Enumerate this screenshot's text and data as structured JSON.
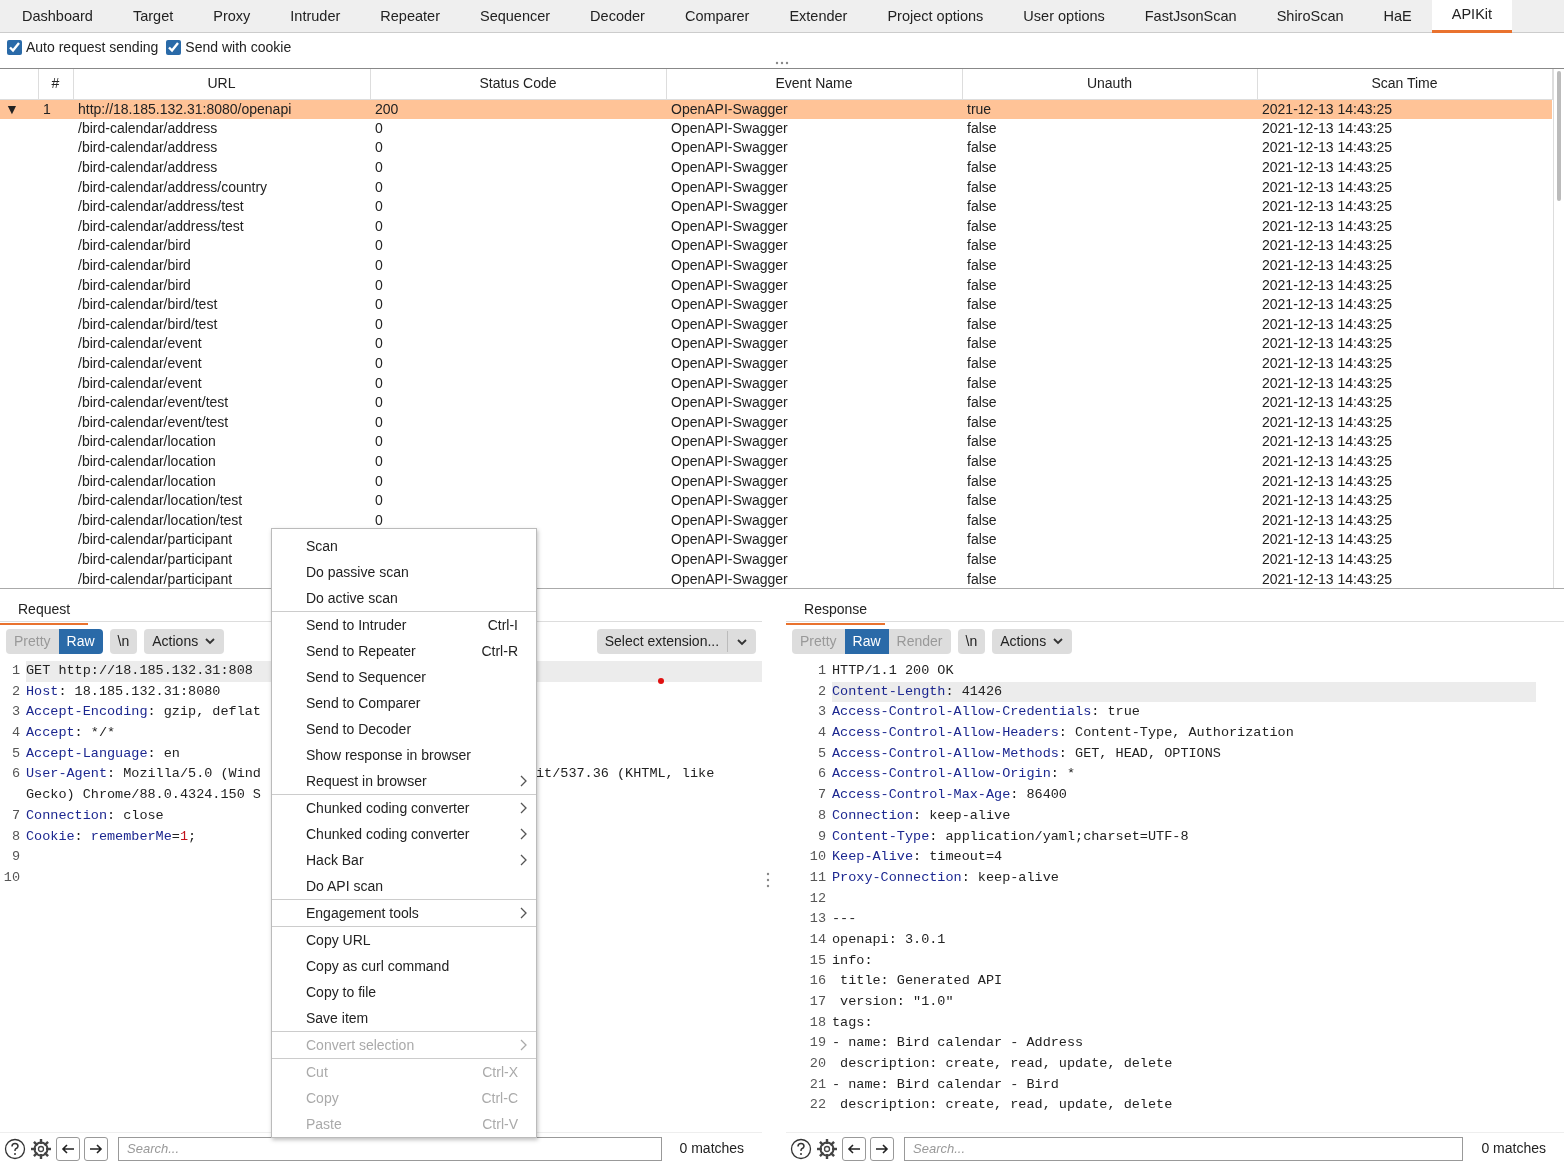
{
  "tabs": [
    {
      "label": "Dashboard",
      "selected": false
    },
    {
      "label": "Target",
      "selected": false
    },
    {
      "label": "Proxy",
      "selected": false
    },
    {
      "label": "Intruder",
      "selected": false
    },
    {
      "label": "Repeater",
      "selected": false
    },
    {
      "label": "Sequencer",
      "selected": false
    },
    {
      "label": "Decoder",
      "selected": false
    },
    {
      "label": "Comparer",
      "selected": false
    },
    {
      "label": "Extender",
      "selected": false
    },
    {
      "label": "Project options",
      "selected": false
    },
    {
      "label": "User options",
      "selected": false
    },
    {
      "label": "FastJsonScan",
      "selected": false
    },
    {
      "label": "ShiroScan",
      "selected": false
    },
    {
      "label": "HaE",
      "selected": false
    },
    {
      "label": "APIKit",
      "selected": true
    }
  ],
  "options": [
    {
      "label": "Auto request sending",
      "checked": true
    },
    {
      "label": "Send with cookie",
      "checked": true
    }
  ],
  "table": {
    "columns": [
      "#",
      "URL",
      "Status Code",
      "Event Name",
      "Unauth",
      "Scan Time"
    ],
    "rows": [
      {
        "expander": "▼",
        "num": "1",
        "url": "http://18.185.132.31:8080/openapi",
        "status": "200",
        "event": "OpenAPI-Swagger",
        "unauth": "true",
        "time": "2021-12-13 14:43:25",
        "selected": true
      },
      {
        "url": "/bird-calendar/address",
        "status": "0",
        "event": "OpenAPI-Swagger",
        "unauth": "false",
        "time": "2021-12-13 14:43:25",
        "selected": false
      },
      {
        "url": "/bird-calendar/address",
        "status": "0",
        "event": "OpenAPI-Swagger",
        "unauth": "false",
        "time": "2021-12-13 14:43:25",
        "selected": false
      },
      {
        "url": "/bird-calendar/address",
        "status": "0",
        "event": "OpenAPI-Swagger",
        "unauth": "false",
        "time": "2021-12-13 14:43:25",
        "selected": false
      },
      {
        "url": "/bird-calendar/address/country",
        "status": "0",
        "event": "OpenAPI-Swagger",
        "unauth": "false",
        "time": "2021-12-13 14:43:25",
        "selected": false
      },
      {
        "url": "/bird-calendar/address/test",
        "status": "0",
        "event": "OpenAPI-Swagger",
        "unauth": "false",
        "time": "2021-12-13 14:43:25",
        "selected": false
      },
      {
        "url": "/bird-calendar/address/test",
        "status": "0",
        "event": "OpenAPI-Swagger",
        "unauth": "false",
        "time": "2021-12-13 14:43:25",
        "selected": false
      },
      {
        "url": "/bird-calendar/bird",
        "status": "0",
        "event": "OpenAPI-Swagger",
        "unauth": "false",
        "time": "2021-12-13 14:43:25",
        "selected": false
      },
      {
        "url": "/bird-calendar/bird",
        "status": "0",
        "event": "OpenAPI-Swagger",
        "unauth": "false",
        "time": "2021-12-13 14:43:25",
        "selected": false
      },
      {
        "url": "/bird-calendar/bird",
        "status": "0",
        "event": "OpenAPI-Swagger",
        "unauth": "false",
        "time": "2021-12-13 14:43:25",
        "selected": false
      },
      {
        "url": "/bird-calendar/bird/test",
        "status": "0",
        "event": "OpenAPI-Swagger",
        "unauth": "false",
        "time": "2021-12-13 14:43:25",
        "selected": false
      },
      {
        "url": "/bird-calendar/bird/test",
        "status": "0",
        "event": "OpenAPI-Swagger",
        "unauth": "false",
        "time": "2021-12-13 14:43:25",
        "selected": false
      },
      {
        "url": "/bird-calendar/event",
        "status": "0",
        "event": "OpenAPI-Swagger",
        "unauth": "false",
        "time": "2021-12-13 14:43:25",
        "selected": false
      },
      {
        "url": "/bird-calendar/event",
        "status": "0",
        "event": "OpenAPI-Swagger",
        "unauth": "false",
        "time": "2021-12-13 14:43:25",
        "selected": false
      },
      {
        "url": "/bird-calendar/event",
        "status": "0",
        "event": "OpenAPI-Swagger",
        "unauth": "false",
        "time": "2021-12-13 14:43:25",
        "selected": false
      },
      {
        "url": "/bird-calendar/event/test",
        "status": "0",
        "event": "OpenAPI-Swagger",
        "unauth": "false",
        "time": "2021-12-13 14:43:25",
        "selected": false
      },
      {
        "url": "/bird-calendar/event/test",
        "status": "0",
        "event": "OpenAPI-Swagger",
        "unauth": "false",
        "time": "2021-12-13 14:43:25",
        "selected": false
      },
      {
        "url": "/bird-calendar/location",
        "status": "0",
        "event": "OpenAPI-Swagger",
        "unauth": "false",
        "time": "2021-12-13 14:43:25",
        "selected": false
      },
      {
        "url": "/bird-calendar/location",
        "status": "0",
        "event": "OpenAPI-Swagger",
        "unauth": "false",
        "time": "2021-12-13 14:43:25",
        "selected": false
      },
      {
        "url": "/bird-calendar/location",
        "status": "0",
        "event": "OpenAPI-Swagger",
        "unauth": "false",
        "time": "2021-12-13 14:43:25",
        "selected": false
      },
      {
        "url": "/bird-calendar/location/test",
        "status": "0",
        "event": "OpenAPI-Swagger",
        "unauth": "false",
        "time": "2021-12-13 14:43:25",
        "selected": false
      },
      {
        "url": "/bird-calendar/location/test",
        "status": "0",
        "event": "OpenAPI-Swagger",
        "unauth": "false",
        "time": "2021-12-13 14:43:25",
        "selected": false
      },
      {
        "url": "/bird-calendar/participant",
        "event": "OpenAPI-Swagger",
        "unauth": "false",
        "time": "2021-12-13 14:43:25",
        "selected": false
      },
      {
        "url": "/bird-calendar/participant",
        "event": "OpenAPI-Swagger",
        "unauth": "false",
        "time": "2021-12-13 14:43:25",
        "selected": false
      },
      {
        "url": "/bird-calendar/participant",
        "event": "OpenAPI-Swagger",
        "unauth": "false",
        "time": "2021-12-13 14:43:25",
        "selected": false
      }
    ]
  },
  "request": {
    "tab": "Request",
    "view_buttons": [
      {
        "label": "Pretty",
        "selected": false
      },
      {
        "label": "Raw",
        "selected": true
      }
    ],
    "newline_button": "\\n",
    "actions": "Actions",
    "extension_select": "Select extension...",
    "lines": [
      {
        "num": "1",
        "highlighted": true,
        "segments": [
          {
            "kind": "plain",
            "text": "GET http://18.185.132.31:808"
          }
        ]
      },
      {
        "num": "2",
        "segments": [
          {
            "kind": "key",
            "text": "Host"
          },
          {
            "kind": "plain",
            "text": ": 18.185.132.31:8080"
          }
        ]
      },
      {
        "num": "3",
        "segments": [
          {
            "kind": "key",
            "text": "Accept-Encoding"
          },
          {
            "kind": "plain",
            "text": ": gzip, deflat"
          }
        ]
      },
      {
        "num": "4",
        "segments": [
          {
            "kind": "key",
            "text": "Accept"
          },
          {
            "kind": "plain",
            "text": ": */*"
          }
        ]
      },
      {
        "num": "5",
        "segments": [
          {
            "kind": "key",
            "text": "Accept-Language"
          },
          {
            "kind": "plain",
            "text": ": en"
          }
        ]
      },
      {
        "num": "6",
        "segments": [
          {
            "kind": "key",
            "text": "User-Agent"
          },
          {
            "kind": "plain",
            "text": ": Mozilla/5.0 (Wind"
          }
        ],
        "after": "it/537.36 (KHTML, like"
      },
      {
        "segments": [
          {
            "kind": "plain",
            "text": "Gecko) Chrome/88.0.4324.150 S"
          }
        ]
      },
      {
        "num": "7",
        "segments": [
          {
            "kind": "key",
            "text": "Connection"
          },
          {
            "kind": "plain",
            "text": ": close"
          }
        ]
      },
      {
        "num": "8",
        "segments": [
          {
            "kind": "key",
            "text": "Cookie"
          },
          {
            "kind": "plain",
            "text": ": "
          },
          {
            "kind": "param",
            "text": "rememberMe"
          },
          {
            "kind": "plain",
            "text": "="
          },
          {
            "kind": "number",
            "text": "1"
          },
          {
            "kind": "plain",
            "text": ";"
          }
        ]
      },
      {
        "num": "9"
      },
      {
        "num": "10"
      }
    ],
    "search": {
      "placeholder": "Search...",
      "matches": "0 matches"
    }
  },
  "response": {
    "tab": "Response",
    "view_buttons": [
      {
        "label": "Pretty",
        "selected": false
      },
      {
        "label": "Raw",
        "selected": true
      },
      {
        "label": "Render",
        "selected": false
      }
    ],
    "newline_button": "\\n",
    "actions": "Actions",
    "lines": [
      {
        "num": "1",
        "segments": [
          {
            "kind": "plain",
            "text": "HTTP/1.1 200 OK"
          }
        ]
      },
      {
        "num": "2",
        "highlighted": true,
        "segments": [
          {
            "kind": "key",
            "text": "Content-Length"
          },
          {
            "kind": "plain",
            "text": ": 41426"
          }
        ]
      },
      {
        "num": "3",
        "segments": [
          {
            "kind": "key",
            "text": "Access-Control-Allow-Credentials"
          },
          {
            "kind": "plain",
            "text": ": true"
          }
        ]
      },
      {
        "num": "4",
        "segments": [
          {
            "kind": "key",
            "text": "Access-Control-Allow-Headers"
          },
          {
            "kind": "plain",
            "text": ": Content-Type, Authorization"
          }
        ]
      },
      {
        "num": "5",
        "segments": [
          {
            "kind": "key",
            "text": "Access-Control-Allow-Methods"
          },
          {
            "kind": "plain",
            "text": ": GET, HEAD, OPTIONS"
          }
        ]
      },
      {
        "num": "6",
        "segments": [
          {
            "kind": "key",
            "text": "Access-Control-Allow-Origin"
          },
          {
            "kind": "plain",
            "text": ": *"
          }
        ]
      },
      {
        "num": "7",
        "segments": [
          {
            "kind": "key",
            "text": "Access-Control-Max-Age"
          },
          {
            "kind": "plain",
            "text": ": 86400"
          }
        ]
      },
      {
        "num": "8",
        "segments": [
          {
            "kind": "key",
            "text": "Connection"
          },
          {
            "kind": "plain",
            "text": ": keep-alive"
          }
        ]
      },
      {
        "num": "9",
        "segments": [
          {
            "kind": "key",
            "text": "Content-Type"
          },
          {
            "kind": "plain",
            "text": ": application/yaml;charset=UTF-8"
          }
        ]
      },
      {
        "num": "10",
        "segments": [
          {
            "kind": "key",
            "text": "Keep-Alive"
          },
          {
            "kind": "plain",
            "text": ": timeout=4"
          }
        ]
      },
      {
        "num": "11",
        "segments": [
          {
            "kind": "key",
            "text": "Proxy-Connection"
          },
          {
            "kind": "plain",
            "text": ": keep-alive"
          }
        ]
      },
      {
        "num": "12"
      },
      {
        "num": "13",
        "segments": [
          {
            "kind": "plain",
            "text": "---"
          }
        ]
      },
      {
        "num": "14",
        "segments": [
          {
            "kind": "plain",
            "text": "openapi: 3.0.1"
          }
        ]
      },
      {
        "num": "15",
        "segments": [
          {
            "kind": "plain",
            "text": "info:"
          }
        ]
      },
      {
        "num": "16",
        "segments": [
          {
            "kind": "plain",
            "text": " title: Generated API"
          }
        ]
      },
      {
        "num": "17",
        "segments": [
          {
            "kind": "plain",
            "text": " version: \"1.0\""
          }
        ]
      },
      {
        "num": "18",
        "segments": [
          {
            "kind": "plain",
            "text": "tags:"
          }
        ]
      },
      {
        "num": "19",
        "segments": [
          {
            "kind": "plain",
            "text": "- name: Bird calendar - Address"
          }
        ]
      },
      {
        "num": "20",
        "segments": [
          {
            "kind": "plain",
            "text": " description: create, read, update, delete"
          }
        ]
      },
      {
        "num": "21",
        "segments": [
          {
            "kind": "plain",
            "text": "- name: Bird calendar - Bird"
          }
        ]
      },
      {
        "num": "22",
        "segments": [
          {
            "kind": "plain",
            "text": " description: create, read, update, delete"
          }
        ]
      }
    ],
    "search": {
      "placeholder": "Search...",
      "matches": "0 matches"
    }
  },
  "context_menu": [
    {
      "kind": "item",
      "label": "Scan",
      "disabled": false
    },
    {
      "kind": "item",
      "label": "Do passive scan",
      "disabled": false
    },
    {
      "kind": "item",
      "label": "Do active scan",
      "disabled": false
    },
    {
      "kind": "separator"
    },
    {
      "kind": "item",
      "label": "Send to Intruder",
      "shortcut": "Ctrl-I",
      "disabled": false
    },
    {
      "kind": "item",
      "label": "Send to Repeater",
      "shortcut": "Ctrl-R",
      "disabled": false
    },
    {
      "kind": "item",
      "label": "Send to Sequencer",
      "disabled": false
    },
    {
      "kind": "item",
      "label": "Send to Comparer",
      "disabled": false
    },
    {
      "kind": "item",
      "label": "Send to Decoder",
      "disabled": false
    },
    {
      "kind": "item",
      "label": "Show response in browser",
      "disabled": false
    },
    {
      "kind": "item",
      "label": "Request in browser",
      "submenu": true,
      "disabled": false
    },
    {
      "kind": "separator"
    },
    {
      "kind": "item",
      "label": "Chunked coding converter",
      "submenu": true,
      "disabled": false
    },
    {
      "kind": "item",
      "label": "Chunked coding converter",
      "submenu": true,
      "disabled": false
    },
    {
      "kind": "item",
      "label": "Hack Bar",
      "submenu": true,
      "disabled": false
    },
    {
      "kind": "item",
      "label": "Do API scan",
      "disabled": false
    },
    {
      "kind": "separator"
    },
    {
      "kind": "item",
      "label": "Engagement tools",
      "submenu": true,
      "disabled": false
    },
    {
      "kind": "separator"
    },
    {
      "kind": "item",
      "label": "Copy URL",
      "disabled": false
    },
    {
      "kind": "item",
      "label": "Copy as curl command",
      "disabled": false
    },
    {
      "kind": "item",
      "label": "Copy to file",
      "disabled": false
    },
    {
      "kind": "item",
      "label": "Save item",
      "disabled": false
    },
    {
      "kind": "separator"
    },
    {
      "kind": "item",
      "label": "Convert selection",
      "submenu": true,
      "disabled": true
    },
    {
      "kind": "separator"
    },
    {
      "kind": "item",
      "label": "Cut",
      "shortcut": "Ctrl-X",
      "disabled": true
    },
    {
      "kind": "item",
      "label": "Copy",
      "shortcut": "Ctrl-C",
      "disabled": true
    },
    {
      "kind": "item",
      "label": "Paste",
      "shortcut": "Ctrl-V",
      "disabled": true
    }
  ]
}
